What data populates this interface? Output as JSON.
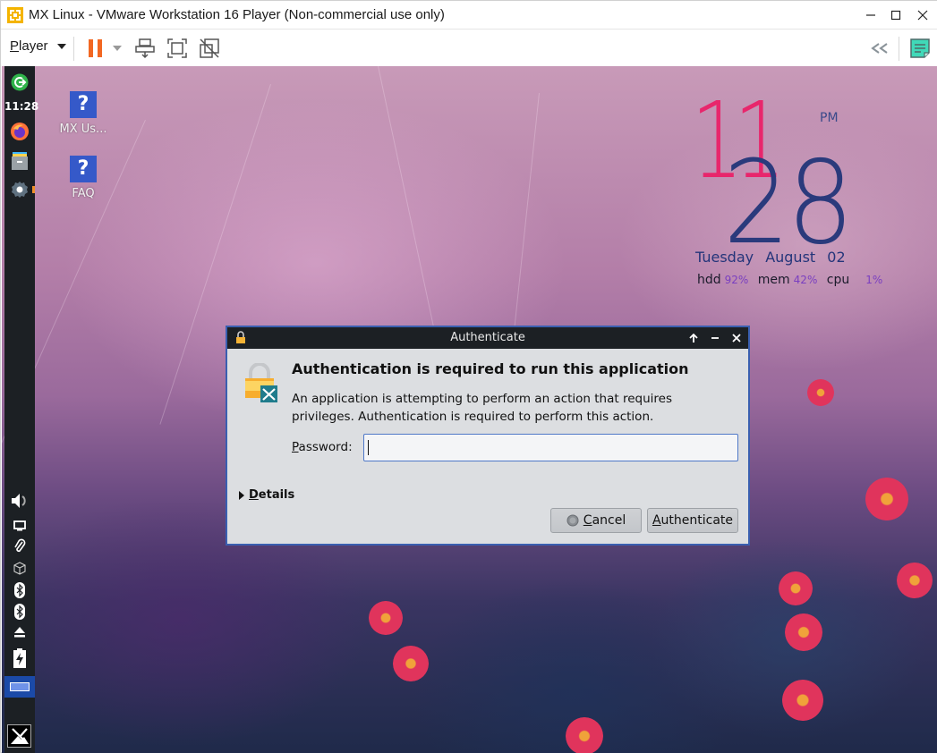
{
  "window": {
    "title": "MX Linux - VMware Workstation 16 Player (Non-commercial use only)",
    "controls": {
      "minimize": "minimize-icon",
      "maximize": "maximize-icon",
      "close": "close-icon"
    }
  },
  "toolbar": {
    "player_menu_label": "Player",
    "player_menu_mnemonic": "P",
    "player_menu_rest": "layer",
    "buttons": [
      {
        "name": "pause",
        "icon": "pause-icon",
        "color": "#f26722"
      },
      {
        "name": "pause-dropdown",
        "icon": "chevron-down-icon"
      },
      {
        "name": "send-ctrl-alt-del",
        "icon": "send-keys-icon"
      },
      {
        "name": "full-screen",
        "icon": "fullscreen-icon"
      },
      {
        "name": "unity",
        "icon": "unity-icon"
      }
    ],
    "right_buttons": [
      {
        "name": "collapse-toolbar",
        "icon": "double-chevron-left-icon"
      },
      {
        "name": "message-log",
        "icon": "message-log-icon",
        "color": "#40d9b8"
      }
    ]
  },
  "panel": {
    "clock": "11:28",
    "top_items": [
      {
        "name": "logout",
        "icon": "logout-icon",
        "color": "#2fb34a"
      },
      {
        "name": "firefox",
        "icon": "firefox-icon"
      },
      {
        "name": "file-manager",
        "icon": "file-manager-icon"
      },
      {
        "name": "settings",
        "icon": "gear-icon"
      }
    ],
    "tray_items": [
      {
        "name": "volume",
        "icon": "volume-icon"
      },
      {
        "name": "display",
        "icon": "monitor-icon"
      },
      {
        "name": "clipboard",
        "icon": "paperclip-icon"
      },
      {
        "name": "updater",
        "icon": "package-icon"
      },
      {
        "name": "bluetooth-1",
        "icon": "bluetooth-icon"
      },
      {
        "name": "bluetooth-2",
        "icon": "bluetooth-icon"
      },
      {
        "name": "eject",
        "icon": "eject-icon"
      },
      {
        "name": "battery",
        "icon": "battery-charging-icon"
      }
    ],
    "show_desktop": "desktop-pager-icon",
    "menu": "mx-logo-icon"
  },
  "desktop": {
    "icons": [
      {
        "label": "MX Us...",
        "icon": "help-icon",
        "glyph": "?"
      },
      {
        "label": "FAQ",
        "icon": "help-icon",
        "glyph": "?"
      }
    ]
  },
  "conky": {
    "hour": "11",
    "minute": "28",
    "ampm": "PM",
    "day": "Tuesday",
    "date": "August 02",
    "stats": [
      {
        "label": "hdd",
        "value": "92%"
      },
      {
        "label": "mem",
        "value": "42%"
      },
      {
        "label": "cpu",
        "value": "1%"
      }
    ],
    "colors": {
      "hour": "#e8266c",
      "minute": "#2a3a7c",
      "value": "#7a3fc0"
    }
  },
  "dialog": {
    "title": "Authenticate",
    "heading": "Authentication is required to run this application",
    "body": "An application is attempting to perform an action that requires privileges. Authentication is required to perform this action.",
    "password_label_mnemonic": "P",
    "password_label_rest": "assword:",
    "password_value": "",
    "details_mnemonic": "D",
    "details_rest": "etails",
    "cancel_mnemonic": "C",
    "cancel_rest": "ancel",
    "authenticate_mnemonic": "A",
    "authenticate_rest": "uthenticate",
    "title_controls": [
      "keep-above-icon",
      "minimize-icon",
      "close-icon"
    ]
  }
}
